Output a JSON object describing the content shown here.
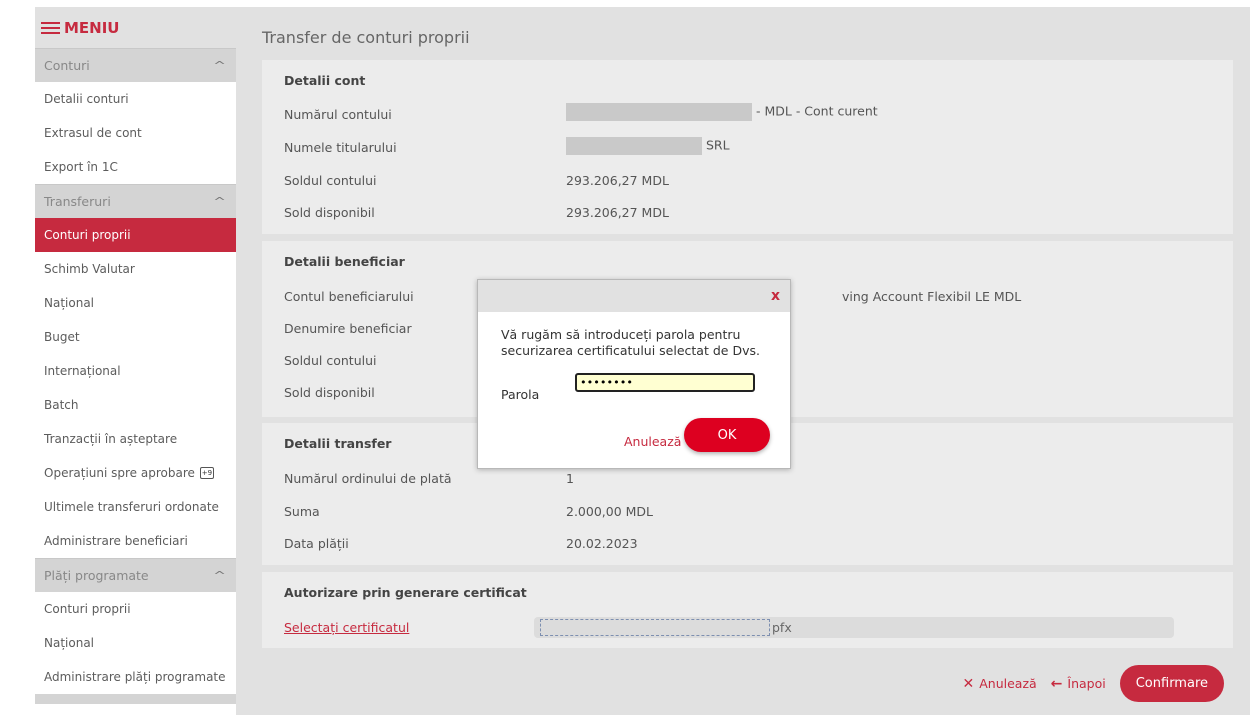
{
  "menu": {
    "title": "MENIU"
  },
  "sidebar": {
    "sections": [
      {
        "label": "Conturi",
        "items": [
          "Detalii conturi",
          "Extrasul de cont",
          "Export în 1C"
        ]
      },
      {
        "label": "Transferuri",
        "items": [
          "Conturi proprii",
          "Schimb Valutar",
          "Național",
          "Buget",
          "Internațional",
          "Batch",
          "Tranzacții în așteptare",
          "Operațiuni spre aprobare",
          "Ultimele transferuri ordonate",
          "Administrare beneficiari"
        ]
      },
      {
        "label": "Plăți programate",
        "items": [
          "Conturi proprii",
          "Național",
          "Administrare plăți programate"
        ]
      }
    ],
    "active_item": "Conturi proprii",
    "approval_badge": "+9"
  },
  "page": {
    "title": "Transfer de conturi proprii"
  },
  "account_details": {
    "title": "Detalii cont",
    "rows": [
      {
        "label": "Numărul contului",
        "value": "- MDL - Cont curent"
      },
      {
        "label": "Numele titularului",
        "value": "SRL"
      },
      {
        "label": "Soldul contului",
        "value": "293.206,27 MDL"
      },
      {
        "label": "Sold disponibil",
        "value": "293.206,27 MDL"
      }
    ]
  },
  "beneficiary_details": {
    "title": "Detalii beneficiar",
    "rows": [
      {
        "label": "Contul beneficiarului",
        "value": "ving Account Flexibil LE MDL"
      },
      {
        "label": "Denumire beneficiar",
        "value": ""
      },
      {
        "label": "Soldul contului",
        "value": ""
      },
      {
        "label": "Sold disponibil",
        "value": ""
      }
    ]
  },
  "transfer_details": {
    "title": "Detalii transfer",
    "rows": [
      {
        "label": "Numărul ordinului de plată",
        "value": "1"
      },
      {
        "label": "Suma",
        "value": "2.000,00 MDL"
      },
      {
        "label": "Data plății",
        "value": "20.02.2023"
      }
    ]
  },
  "authorization": {
    "title": "Autorizare prin generare certificat",
    "select_link": "Selectați certificatul",
    "file_ext": "pfx"
  },
  "actions": {
    "cancel": "Anulează",
    "back": "Înapoi",
    "confirm": "Confirmare"
  },
  "modal": {
    "close": "x",
    "message": "Vă rugăm să introduceți parola pentru securizarea certificatului selectat de Dvs.",
    "password_label": "Parola",
    "password_value": "••••••••",
    "cancel": "Anulează",
    "ok": "OK"
  },
  "colors": {
    "accent": "#c62a3f",
    "ok_button": "#dd0020",
    "input_bg": "#ffffd2"
  }
}
